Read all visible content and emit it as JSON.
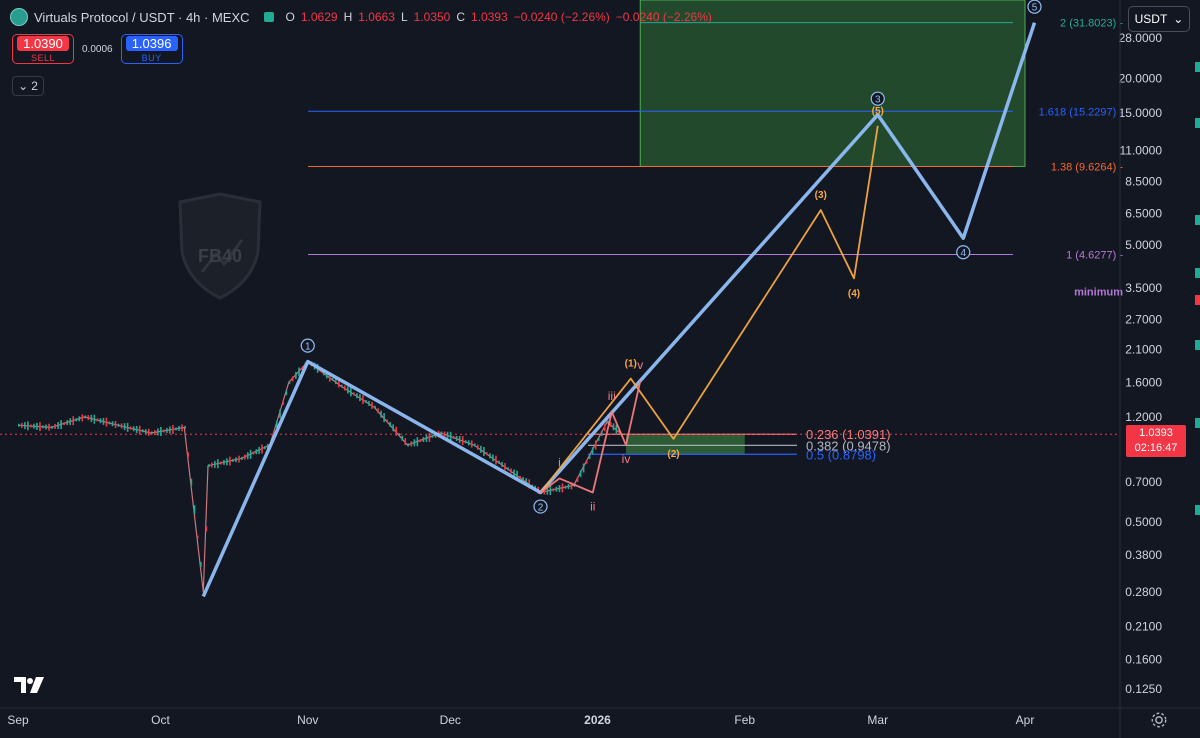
{
  "header": {
    "symbol": "Virtuals Protocol / USDT · 4h · MEXC",
    "ohlc": [
      {
        "k": "O",
        "v": "1.0629"
      },
      {
        "k": "H",
        "v": "1.0663"
      },
      {
        "k": "L",
        "v": "1.0350"
      },
      {
        "k": "C",
        "v": "1.0393"
      }
    ],
    "change": "−0.0240 (−2.26%)",
    "change2": "−0.0240 (−2.26%)"
  },
  "trade": {
    "sell_price": "1.0390",
    "sell_label": "SELL",
    "spread": "0.0006",
    "buy_price": "1.0396",
    "buy_label": "BUY"
  },
  "indicators_count": "2",
  "currency": "USDT",
  "last_price": {
    "value": "1.0393",
    "countdown": "02:16:47"
  },
  "watermark": "FB40",
  "colors": {
    "bg": "#131722",
    "up": "#22ab94",
    "down": "#f23645",
    "wave_main": "#90bff9",
    "wave_orange": "#f7a945",
    "wave_pink": "#f77c80",
    "fib_blue": "#2962ff",
    "fib_orange": "#f2682d",
    "fib_purple": "#b678d8",
    "target_zone": "#2e7d32"
  },
  "chart_data": {
    "type": "line",
    "title": "Virtuals Protocol / USDT · 4h · MEXC",
    "scale": "log",
    "ylim": [
      0.1,
      40
    ],
    "y_ticks": [
      "28.0000",
      "20.0000",
      "15.0000",
      "11.0000",
      "8.5000",
      "6.5000",
      "5.0000",
      "3.5000",
      "2.7000",
      "2.1000",
      "1.6000",
      "1.2000",
      "0.7000",
      "0.5000",
      "0.3800",
      "0.2800",
      "0.2100",
      "0.1600",
      "0.1250"
    ],
    "y_tick_values": [
      28,
      20,
      15,
      11,
      8.5,
      6.5,
      5,
      3.5,
      2.7,
      2.1,
      1.6,
      1.2,
      0.7,
      0.5,
      0.38,
      0.28,
      0.21,
      0.16,
      0.125
    ],
    "x_ticks": [
      "Sep",
      "Oct",
      "Nov",
      "Dec",
      "2026",
      "Feb",
      "Mar",
      "Apr"
    ],
    "x_tick_dates": [
      "2025-09-01",
      "2025-10-01",
      "2025-11-01",
      "2025-12-01",
      "2026-01-01",
      "2026-02-01",
      "2026-03-01",
      "2026-04-01"
    ],
    "fib_levels": [
      {
        "label": "2 (31.8023)",
        "value": 31.8023,
        "color": "#22ab94"
      },
      {
        "label": "1.618 (15.2297)",
        "value": 15.2297,
        "color": "#2962ff"
      },
      {
        "label": "1.38 (9.6264)",
        "value": 9.6264,
        "color": "#f2682d"
      },
      {
        "label": "1 (4.6277)",
        "value": 4.6277,
        "color": "#b678d8"
      }
    ],
    "retracements": [
      {
        "label": "0.236 (1.0391)",
        "value": 1.0391,
        "color": "#f77c80"
      },
      {
        "label": "0.382 (0.9478)",
        "value": 0.9478,
        "color": "#b2b5be"
      },
      {
        "label": "0.5 (0.8798)",
        "value": 0.8798,
        "color": "#2962ff"
      }
    ],
    "minimum_label": "minimum",
    "target_zone": {
      "from": "2026-01-10",
      "to": "2026-04-01",
      "low": 9.6264,
      "high": 40
    },
    "series": [
      {
        "name": "",
        "color": "#90bff9",
        "points": [
          {
            "x": "2025-10-10",
            "y": 0.27
          },
          {
            "x": "2025-11-01",
            "y": 1.9,
            "label": "1"
          },
          {
            "x": "2025-12-20",
            "y": 0.64,
            "label": "2"
          },
          {
            "x": "2026-03-01",
            "y": 14.8,
            "label": "3"
          },
          {
            "x": "2026-03-19",
            "y": 5.3,
            "label": "4"
          },
          {
            "x": "2026-04-03",
            "y": 31.8,
            "label": "5"
          }
        ]
      },
      {
        "name": "",
        "color": "#f7a945",
        "points": [
          {
            "x": "2025-12-20",
            "y": 0.64
          },
          {
            "x": "2026-01-08",
            "y": 1.65,
            "label": "(1)"
          },
          {
            "x": "2026-01-17",
            "y": 1.0,
            "label": "(2)"
          },
          {
            "x": "2026-02-17",
            "y": 6.7,
            "label": "(3)"
          },
          {
            "x": "2026-02-24",
            "y": 3.8,
            "label": "(4)"
          },
          {
            "x": "2026-03-01",
            "y": 13.5,
            "label": "(5)"
          }
        ]
      },
      {
        "name": "",
        "color": "#f77c80",
        "points": [
          {
            "x": "2025-12-20",
            "y": 0.64
          },
          {
            "x": "2025-12-24",
            "y": 0.72,
            "label": "i"
          },
          {
            "x": "2025-12-31",
            "y": 0.64,
            "label": "ii"
          },
          {
            "x": "2026-01-04",
            "y": 1.25,
            "label": "iii"
          },
          {
            "x": "2026-01-07",
            "y": 0.95,
            "label": "iv"
          },
          {
            "x": "2026-01-10",
            "y": 1.62,
            "label": "v"
          }
        ]
      }
    ],
    "price_history": [
      {
        "x": "2025-09-01",
        "y": 1.12
      },
      {
        "x": "2025-09-08",
        "y": 1.1
      },
      {
        "x": "2025-09-15",
        "y": 1.2
      },
      {
        "x": "2025-09-22",
        "y": 1.12
      },
      {
        "x": "2025-09-29",
        "y": 1.05
      },
      {
        "x": "2025-10-06",
        "y": 1.1
      },
      {
        "x": "2025-10-10",
        "y": 0.28
      },
      {
        "x": "2025-10-11",
        "y": 0.8
      },
      {
        "x": "2025-10-18",
        "y": 0.85
      },
      {
        "x": "2025-10-24",
        "y": 0.95
      },
      {
        "x": "2025-10-28",
        "y": 1.6
      },
      {
        "x": "2025-11-01",
        "y": 1.9
      },
      {
        "x": "2025-11-08",
        "y": 1.55
      },
      {
        "x": "2025-11-15",
        "y": 1.3
      },
      {
        "x": "2025-11-22",
        "y": 0.95
      },
      {
        "x": "2025-11-29",
        "y": 1.05
      },
      {
        "x": "2025-12-06",
        "y": 0.95
      },
      {
        "x": "2025-12-13",
        "y": 0.78
      },
      {
        "x": "2025-12-20",
        "y": 0.64
      },
      {
        "x": "2025-12-27",
        "y": 0.68
      },
      {
        "x": "2026-01-03",
        "y": 1.15
      },
      {
        "x": "2026-01-06",
        "y": 1.04
      }
    ]
  }
}
